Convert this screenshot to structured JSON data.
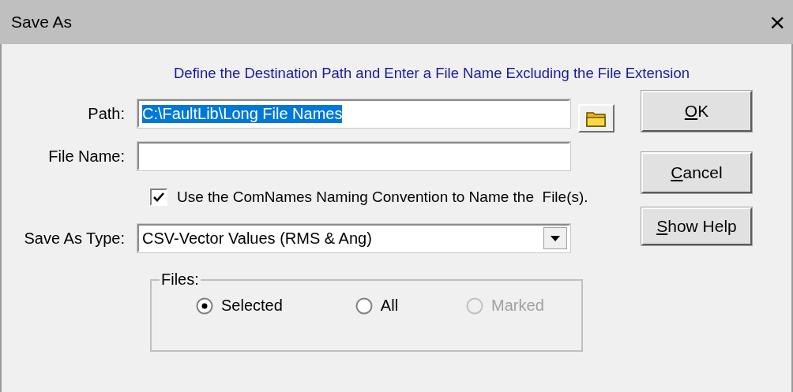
{
  "window": {
    "title": "Save As",
    "close": "×"
  },
  "heading": "Define the Destination Path and Enter a File Name Excluding the File Extension",
  "path": {
    "label": "Path:",
    "value": "C:\\FaultLib\\Long File Names"
  },
  "file_name": {
    "label": "File Name:"
  },
  "naming_convention": {
    "label": "Use the ComNames Naming Convention to Name the  File(s).",
    "checked": true
  },
  "save_as_type": {
    "label": "Save As Type:",
    "value": "CSV-Vector Values (RMS & Ang)"
  },
  "files": {
    "legend": "Files:",
    "options": [
      {
        "label": "Selected",
        "selected": true,
        "disabled": false
      },
      {
        "label": "All",
        "selected": false,
        "disabled": false
      },
      {
        "label": "Marked",
        "selected": false,
        "disabled": true
      }
    ]
  },
  "buttons": [
    {
      "mnemonic": "O",
      "rest": "K"
    },
    {
      "mnemonic": "C",
      "rest": "ancel"
    },
    {
      "mnemonic": "S",
      "rest": "how Help"
    }
  ]
}
